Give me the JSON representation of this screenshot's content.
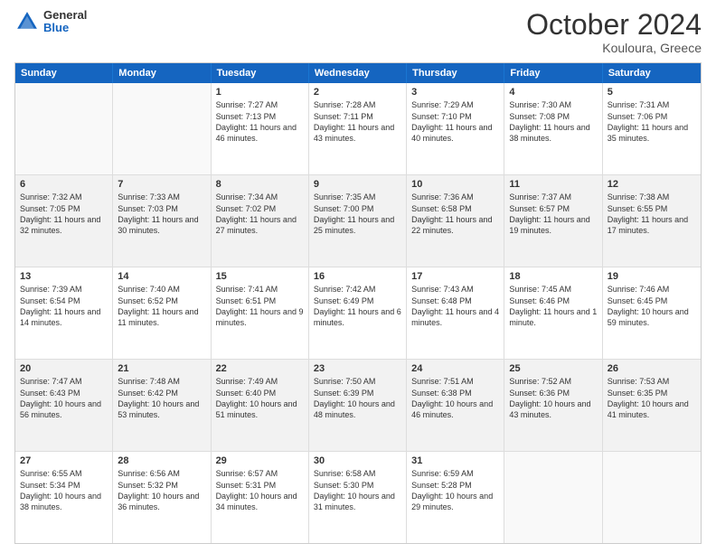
{
  "header": {
    "logo_general": "General",
    "logo_blue": "Blue",
    "month_title": "October 2024",
    "location": "Kouloura, Greece"
  },
  "weekdays": [
    "Sunday",
    "Monday",
    "Tuesday",
    "Wednesday",
    "Thursday",
    "Friday",
    "Saturday"
  ],
  "weeks": [
    [
      {
        "day": "",
        "info": "",
        "empty": true
      },
      {
        "day": "",
        "info": "",
        "empty": true
      },
      {
        "day": "1",
        "info": "Sunrise: 7:27 AM\nSunset: 7:13 PM\nDaylight: 11 hours and 46 minutes."
      },
      {
        "day": "2",
        "info": "Sunrise: 7:28 AM\nSunset: 7:11 PM\nDaylight: 11 hours and 43 minutes."
      },
      {
        "day": "3",
        "info": "Sunrise: 7:29 AM\nSunset: 7:10 PM\nDaylight: 11 hours and 40 minutes."
      },
      {
        "day": "4",
        "info": "Sunrise: 7:30 AM\nSunset: 7:08 PM\nDaylight: 11 hours and 38 minutes."
      },
      {
        "day": "5",
        "info": "Sunrise: 7:31 AM\nSunset: 7:06 PM\nDaylight: 11 hours and 35 minutes."
      }
    ],
    [
      {
        "day": "6",
        "info": "Sunrise: 7:32 AM\nSunset: 7:05 PM\nDaylight: 11 hours and 32 minutes."
      },
      {
        "day": "7",
        "info": "Sunrise: 7:33 AM\nSunset: 7:03 PM\nDaylight: 11 hours and 30 minutes."
      },
      {
        "day": "8",
        "info": "Sunrise: 7:34 AM\nSunset: 7:02 PM\nDaylight: 11 hours and 27 minutes."
      },
      {
        "day": "9",
        "info": "Sunrise: 7:35 AM\nSunset: 7:00 PM\nDaylight: 11 hours and 25 minutes."
      },
      {
        "day": "10",
        "info": "Sunrise: 7:36 AM\nSunset: 6:58 PM\nDaylight: 11 hours and 22 minutes."
      },
      {
        "day": "11",
        "info": "Sunrise: 7:37 AM\nSunset: 6:57 PM\nDaylight: 11 hours and 19 minutes."
      },
      {
        "day": "12",
        "info": "Sunrise: 7:38 AM\nSunset: 6:55 PM\nDaylight: 11 hours and 17 minutes."
      }
    ],
    [
      {
        "day": "13",
        "info": "Sunrise: 7:39 AM\nSunset: 6:54 PM\nDaylight: 11 hours and 14 minutes."
      },
      {
        "day": "14",
        "info": "Sunrise: 7:40 AM\nSunset: 6:52 PM\nDaylight: 11 hours and 11 minutes."
      },
      {
        "day": "15",
        "info": "Sunrise: 7:41 AM\nSunset: 6:51 PM\nDaylight: 11 hours and 9 minutes."
      },
      {
        "day": "16",
        "info": "Sunrise: 7:42 AM\nSunset: 6:49 PM\nDaylight: 11 hours and 6 minutes."
      },
      {
        "day": "17",
        "info": "Sunrise: 7:43 AM\nSunset: 6:48 PM\nDaylight: 11 hours and 4 minutes."
      },
      {
        "day": "18",
        "info": "Sunrise: 7:45 AM\nSunset: 6:46 PM\nDaylight: 11 hours and 1 minute."
      },
      {
        "day": "19",
        "info": "Sunrise: 7:46 AM\nSunset: 6:45 PM\nDaylight: 10 hours and 59 minutes."
      }
    ],
    [
      {
        "day": "20",
        "info": "Sunrise: 7:47 AM\nSunset: 6:43 PM\nDaylight: 10 hours and 56 minutes."
      },
      {
        "day": "21",
        "info": "Sunrise: 7:48 AM\nSunset: 6:42 PM\nDaylight: 10 hours and 53 minutes."
      },
      {
        "day": "22",
        "info": "Sunrise: 7:49 AM\nSunset: 6:40 PM\nDaylight: 10 hours and 51 minutes."
      },
      {
        "day": "23",
        "info": "Sunrise: 7:50 AM\nSunset: 6:39 PM\nDaylight: 10 hours and 48 minutes."
      },
      {
        "day": "24",
        "info": "Sunrise: 7:51 AM\nSunset: 6:38 PM\nDaylight: 10 hours and 46 minutes."
      },
      {
        "day": "25",
        "info": "Sunrise: 7:52 AM\nSunset: 6:36 PM\nDaylight: 10 hours and 43 minutes."
      },
      {
        "day": "26",
        "info": "Sunrise: 7:53 AM\nSunset: 6:35 PM\nDaylight: 10 hours and 41 minutes."
      }
    ],
    [
      {
        "day": "27",
        "info": "Sunrise: 6:55 AM\nSunset: 5:34 PM\nDaylight: 10 hours and 38 minutes."
      },
      {
        "day": "28",
        "info": "Sunrise: 6:56 AM\nSunset: 5:32 PM\nDaylight: 10 hours and 36 minutes."
      },
      {
        "day": "29",
        "info": "Sunrise: 6:57 AM\nSunset: 5:31 PM\nDaylight: 10 hours and 34 minutes."
      },
      {
        "day": "30",
        "info": "Sunrise: 6:58 AM\nSunset: 5:30 PM\nDaylight: 10 hours and 31 minutes."
      },
      {
        "day": "31",
        "info": "Sunrise: 6:59 AM\nSunset: 5:28 PM\nDaylight: 10 hours and 29 minutes."
      },
      {
        "day": "",
        "info": "",
        "empty": true
      },
      {
        "day": "",
        "info": "",
        "empty": true
      }
    ]
  ]
}
